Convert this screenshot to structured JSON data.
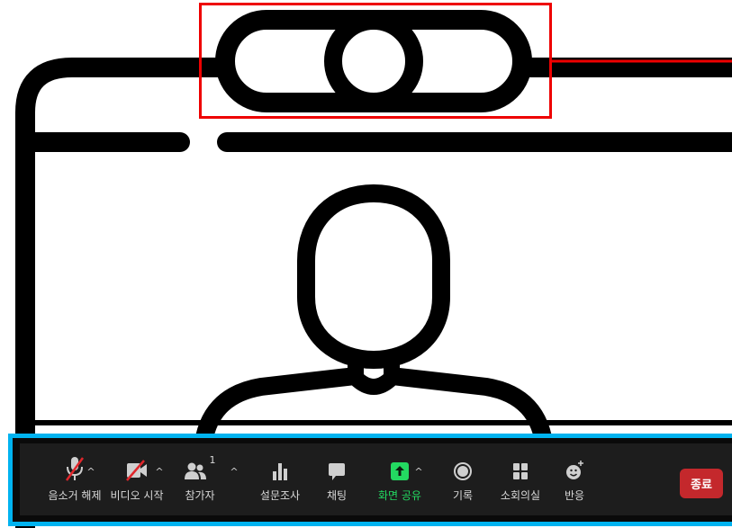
{
  "toolbar": {
    "items": [
      {
        "label": "음소거 해제",
        "icon": "microphone-muted-icon",
        "has_caret": true
      },
      {
        "label": "비디오 시작",
        "icon": "video-camera-off-icon",
        "has_caret": true
      },
      {
        "label": "참가자",
        "icon": "participants-icon",
        "count": "1",
        "has_caret": true
      },
      {
        "label": "설문조사",
        "icon": "poll-bar-chart-icon"
      },
      {
        "label": "채팅",
        "icon": "chat-bubble-icon"
      },
      {
        "label": "화면 공유",
        "icon": "share-screen-icon"
      },
      {
        "label": "기록",
        "icon": "record-icon"
      },
      {
        "label": "소회의실",
        "icon": "breakout-rooms-icon"
      },
      {
        "label": "반응",
        "icon": "reaction-emoji-icon"
      }
    ],
    "end_label": "종료",
    "caret_glyph": "^"
  },
  "colors": {
    "highlight_red": "#ee0000",
    "highlight_blue": "#00b3f0",
    "share_green": "#23d961",
    "end_red": "#c4282c",
    "toolbar_bg": "#1d1d1d"
  }
}
